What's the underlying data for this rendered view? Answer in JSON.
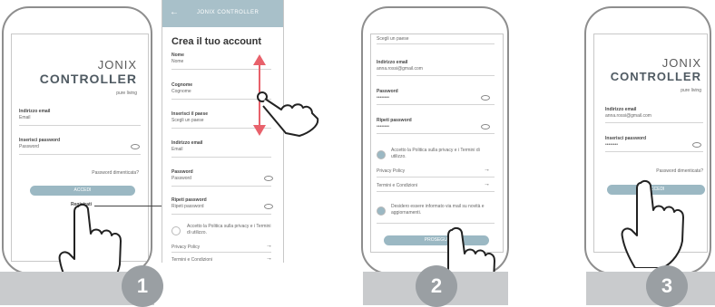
{
  "app": {
    "logo_top": "JONIX",
    "logo_bottom": "CONTROLLER",
    "tagline": "pure living",
    "header_title": "JONIX CONTROLLER"
  },
  "login": {
    "email_label": "Indirizzo email",
    "email_placeholder": "Email",
    "email_filled": "anna.rossi@gmail.com",
    "password_label": "Inserisci password",
    "password_placeholder": "Password",
    "password_dots": "••••••••",
    "forgot": "Password dimenticata?",
    "login_button": "ACCEDI",
    "register_link": "Registrati"
  },
  "signup": {
    "title": "Crea il tuo account",
    "name_label": "Nome",
    "name_placeholder": "Nome",
    "surname_label": "Cognome",
    "surname_placeholder": "Cognome",
    "country_label": "Inserisci il paese",
    "country_placeholder": "Scegli un paese",
    "email_label": "Indirizzo email",
    "email_placeholder": "Email",
    "password_label": "Password",
    "password_placeholder": "Password",
    "repeat_label": "Ripeti password",
    "repeat_placeholder": "Ripeti password",
    "privacy_text": "Accetto la Politica sulla privacy e i Termini di utilizzo.",
    "privacy_link": "Privacy Policy",
    "terms_link": "Termini e Condizioni",
    "newsletter_text": "Desidero essere informato via mail su novità e aggiornamenti.",
    "register_button": "PROSEGUI"
  },
  "steps": [
    "1",
    "2",
    "3"
  ],
  "colors": {
    "accent": "#4f8fa6",
    "button": "#9bb8c3",
    "step_circle": "#9a9fa3",
    "swipe_arrow": "#e8616b"
  }
}
